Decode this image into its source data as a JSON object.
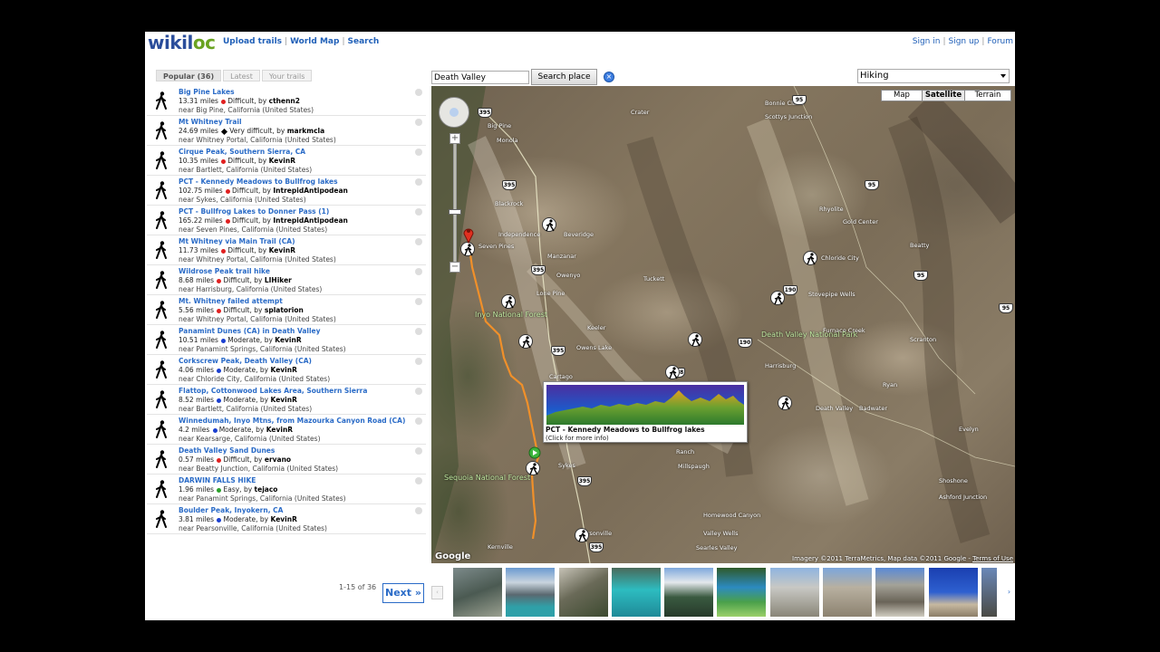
{
  "header": {
    "logo_wiki": "wikil",
    "logo_oc": "oc",
    "nav": [
      "Upload trails",
      "World Map",
      "Search"
    ],
    "auth": [
      "Sign in",
      "Sign up",
      "Forum"
    ]
  },
  "tabs": [
    {
      "label": "Popular (36)",
      "active": true
    },
    {
      "label": "Latest",
      "active": false
    },
    {
      "label": "Your trails",
      "active": false
    }
  ],
  "trails": [
    {
      "name": "Big Pine Lakes",
      "miles": "13.31 miles",
      "difficulty": "Difficult",
      "color": "#e02020",
      "author": "cthenn2",
      "near": "near  Big Pine, California (United States)"
    },
    {
      "name": "Mt Whitney Trail",
      "miles": "24.69 miles",
      "difficulty": "Very difficult",
      "color": "#000000",
      "author": "markmcla",
      "near": "near  Whitney Portal, California (United States)"
    },
    {
      "name": "Cirque Peak, Southern Sierra, CA",
      "miles": "10.35 miles",
      "difficulty": "Difficult",
      "color": "#e02020",
      "author": "KevinR",
      "near": "near  Bartlett, California (United States)"
    },
    {
      "name": "PCT - Kennedy Meadows to Bullfrog lakes",
      "miles": "102.75 miles",
      "difficulty": "Difficult",
      "color": "#e02020",
      "author": "IntrepidAntipodean",
      "near": "near  Sykes, California (United States)"
    },
    {
      "name": "PCT - Bullfrog Lakes to Donner Pass (1)",
      "miles": "165.22 miles",
      "difficulty": "Difficult",
      "color": "#e02020",
      "author": "IntrepidAntipodean",
      "near": "near  Seven Pines, California (United States)"
    },
    {
      "name": "Mt Whitney via Main Trail (CA)",
      "miles": "11.73 miles",
      "difficulty": "Difficult",
      "color": "#e02020",
      "author": "KevinR",
      "near": "near  Whitney Portal, California (United States)"
    },
    {
      "name": "Wildrose Peak trail hike",
      "miles": "8.68 miles",
      "difficulty": "Difficult",
      "color": "#e02020",
      "author": "LIHiker",
      "near": "near  Harrisburg, California (United States)"
    },
    {
      "name": "Mt. Whitney failed attempt",
      "miles": "5.56 miles",
      "difficulty": "Difficult",
      "color": "#e02020",
      "author": "splatorion",
      "near": "near  Whitney Portal, California (United States)"
    },
    {
      "name": "Panamint Dunes (CA) in Death Valley",
      "miles": "10.51 miles",
      "difficulty": "Moderate",
      "color": "#1a3fd0",
      "author": "KevinR",
      "near": "near  Panamint Springs, California (United States)"
    },
    {
      "name": "Corkscrew Peak, Death Valley (CA)",
      "miles": "4.06 miles",
      "difficulty": "Moderate",
      "color": "#1a3fd0",
      "author": "KevinR",
      "near": "near  Chloride City, California (United States)"
    },
    {
      "name": "Flattop, Cottonwood Lakes Area, Southern Sierra",
      "miles": "8.52 miles",
      "difficulty": "Moderate",
      "color": "#1a3fd0",
      "author": "KevinR",
      "near": "near  Bartlett, California (United States)"
    },
    {
      "name": "Winnedumah, Inyo Mtns, from Mazourka Canyon Road (CA)",
      "miles": "4.2 miles",
      "difficulty": "Moderate",
      "color": "#1a3fd0",
      "author": "KevinR",
      "near": "near  Kearsarge, California (United States)"
    },
    {
      "name": "Death Valley Sand Dunes",
      "miles": "0.57 miles",
      "difficulty": "Difficult",
      "color": "#e02020",
      "author": "ervano",
      "near": "near  Beatty Junction, California (United States)"
    },
    {
      "name": "DARWIN FALLS HIKE",
      "miles": "1.96 miles",
      "difficulty": "Easy",
      "color": "#2aa02a",
      "author": "tejaco",
      "near": "near  Panamint Springs, California (United States)"
    },
    {
      "name": "Boulder Peak, Inyokern, CA",
      "miles": "3.81 miles",
      "difficulty": "Moderate",
      "color": "#1a3fd0",
      "author": "KevinR",
      "near": "near  Pearsonville, California (United States)"
    }
  ],
  "search": {
    "value": "Death Valley",
    "button": "Search place",
    "clear_icon": "×"
  },
  "activity": {
    "selected": "Hiking"
  },
  "map": {
    "zoom_in": "+",
    "zoom_out": "−",
    "types": [
      {
        "label": "Map",
        "active": false
      },
      {
        "label": "Satellite",
        "active": true
      },
      {
        "label": "Terrain",
        "active": false
      }
    ],
    "footer": "Imagery ©2011 TerraMetrics, Map data ©2011 Google - ",
    "terms": "Terms of Use",
    "google": "Google",
    "places": [
      "Bishop",
      "Big Pine",
      "Monola",
      "Blackrock",
      "Independence",
      "Seven Pines",
      "Manzanar",
      "Owenyo",
      "Lone Pine",
      "Keeler",
      "Owens Lake",
      "Cartago",
      "Sykes",
      "Pearsonville",
      "Kernville",
      "Fiddlers Gulch",
      "Crater",
      "Bonnie Claire",
      "Scottys Junction",
      "Sarcobatus Flat",
      "Rhyolite",
      "Gold Center",
      "Chloride City",
      "Beatty",
      "Stovepipe Wells",
      "Furnace Creek",
      "Death Valley",
      "Ryan",
      "Badwater",
      "Harrisburg",
      "Ballarat",
      "Trona",
      "Homewood Canyon",
      "Valley Wells",
      "Searles Valley",
      "Ridgecrest",
      "Inyokern",
      "Millspaugh",
      "Ranch",
      "Darwin",
      "Panamint",
      "Tecopa",
      "Shoshone",
      "Ashford Junction",
      "Evelyn",
      "Scranton",
      "Tecope",
      "Death Valley Junction",
      "Amargosa",
      "Tuckett",
      "Beveridge",
      "Johannesburg",
      "Inyo National Forest",
      "Sequoia National Forest",
      "Death Valley National Park"
    ],
    "shields": [
      "395",
      "95",
      "190",
      "178",
      "136"
    ]
  },
  "popup": {
    "title": "PCT - Kennedy Meadows to Bullfrog lakes",
    "subtitle": "(Click for more info)"
  },
  "pager": {
    "range": "1-15 of 36",
    "next": "Next »"
  },
  "photos": {
    "prev": "‹",
    "next": "›"
  }
}
